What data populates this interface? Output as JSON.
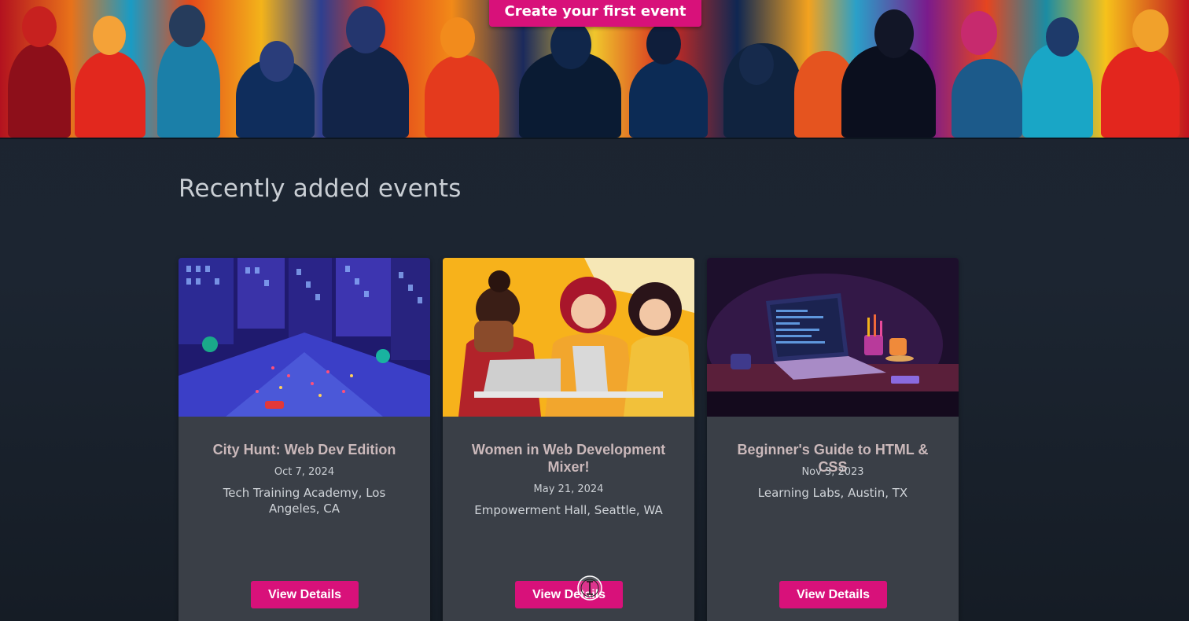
{
  "hero": {
    "cta_label": "Create your first event"
  },
  "section": {
    "title": "Recently added events"
  },
  "events": [
    {
      "title": "City Hunt: Web Dev Edition",
      "date": "Oct 7, 2024",
      "location": "Tech Training Academy, Los Angeles, CA",
      "button_label": "View Details"
    },
    {
      "title": "Women in Web Development Mixer!",
      "date": "May 21, 2024",
      "location": "Empowerment Hall, Seattle, WA",
      "button_label": "View Details"
    },
    {
      "title": "Beginner's Guide to HTML & CSS",
      "date": "Nov 3, 2023",
      "location": "Learning Labs, Austin, TX",
      "button_label": "View Details"
    }
  ],
  "colors": {
    "accent": "#d8117a",
    "background": "#1b2430",
    "card": "#3a3f47"
  }
}
